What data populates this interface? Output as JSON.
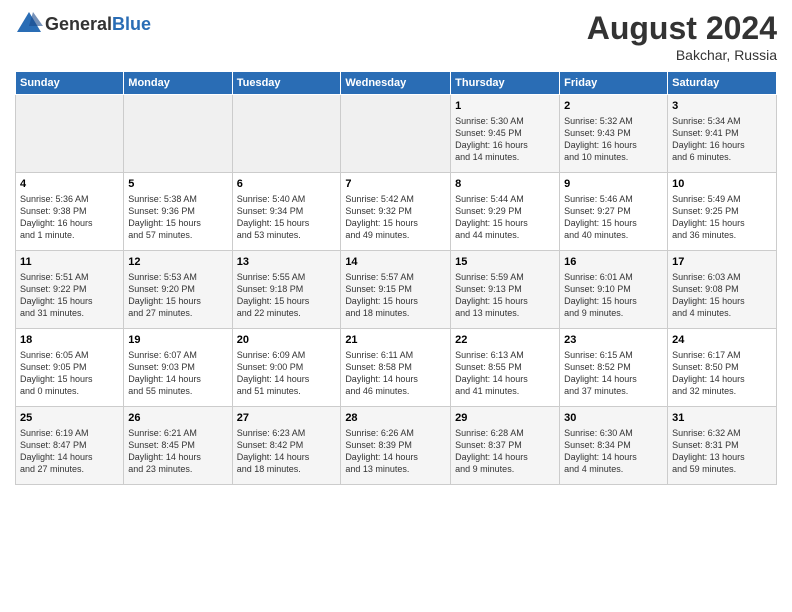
{
  "header": {
    "logo_general": "General",
    "logo_blue": "Blue",
    "month_year": "August 2024",
    "location": "Bakchar, Russia"
  },
  "weekdays": [
    "Sunday",
    "Monday",
    "Tuesday",
    "Wednesday",
    "Thursday",
    "Friday",
    "Saturday"
  ],
  "weeks": [
    [
      {
        "day": "",
        "info": ""
      },
      {
        "day": "",
        "info": ""
      },
      {
        "day": "",
        "info": ""
      },
      {
        "day": "",
        "info": ""
      },
      {
        "day": "1",
        "info": "Sunrise: 5:30 AM\nSunset: 9:45 PM\nDaylight: 16 hours\nand 14 minutes."
      },
      {
        "day": "2",
        "info": "Sunrise: 5:32 AM\nSunset: 9:43 PM\nDaylight: 16 hours\nand 10 minutes."
      },
      {
        "day": "3",
        "info": "Sunrise: 5:34 AM\nSunset: 9:41 PM\nDaylight: 16 hours\nand 6 minutes."
      }
    ],
    [
      {
        "day": "4",
        "info": "Sunrise: 5:36 AM\nSunset: 9:38 PM\nDaylight: 16 hours\nand 1 minute."
      },
      {
        "day": "5",
        "info": "Sunrise: 5:38 AM\nSunset: 9:36 PM\nDaylight: 15 hours\nand 57 minutes."
      },
      {
        "day": "6",
        "info": "Sunrise: 5:40 AM\nSunset: 9:34 PM\nDaylight: 15 hours\nand 53 minutes."
      },
      {
        "day": "7",
        "info": "Sunrise: 5:42 AM\nSunset: 9:32 PM\nDaylight: 15 hours\nand 49 minutes."
      },
      {
        "day": "8",
        "info": "Sunrise: 5:44 AM\nSunset: 9:29 PM\nDaylight: 15 hours\nand 44 minutes."
      },
      {
        "day": "9",
        "info": "Sunrise: 5:46 AM\nSunset: 9:27 PM\nDaylight: 15 hours\nand 40 minutes."
      },
      {
        "day": "10",
        "info": "Sunrise: 5:49 AM\nSunset: 9:25 PM\nDaylight: 15 hours\nand 36 minutes."
      }
    ],
    [
      {
        "day": "11",
        "info": "Sunrise: 5:51 AM\nSunset: 9:22 PM\nDaylight: 15 hours\nand 31 minutes."
      },
      {
        "day": "12",
        "info": "Sunrise: 5:53 AM\nSunset: 9:20 PM\nDaylight: 15 hours\nand 27 minutes."
      },
      {
        "day": "13",
        "info": "Sunrise: 5:55 AM\nSunset: 9:18 PM\nDaylight: 15 hours\nand 22 minutes."
      },
      {
        "day": "14",
        "info": "Sunrise: 5:57 AM\nSunset: 9:15 PM\nDaylight: 15 hours\nand 18 minutes."
      },
      {
        "day": "15",
        "info": "Sunrise: 5:59 AM\nSunset: 9:13 PM\nDaylight: 15 hours\nand 13 minutes."
      },
      {
        "day": "16",
        "info": "Sunrise: 6:01 AM\nSunset: 9:10 PM\nDaylight: 15 hours\nand 9 minutes."
      },
      {
        "day": "17",
        "info": "Sunrise: 6:03 AM\nSunset: 9:08 PM\nDaylight: 15 hours\nand 4 minutes."
      }
    ],
    [
      {
        "day": "18",
        "info": "Sunrise: 6:05 AM\nSunset: 9:05 PM\nDaylight: 15 hours\nand 0 minutes."
      },
      {
        "day": "19",
        "info": "Sunrise: 6:07 AM\nSunset: 9:03 PM\nDaylight: 14 hours\nand 55 minutes."
      },
      {
        "day": "20",
        "info": "Sunrise: 6:09 AM\nSunset: 9:00 PM\nDaylight: 14 hours\nand 51 minutes."
      },
      {
        "day": "21",
        "info": "Sunrise: 6:11 AM\nSunset: 8:58 PM\nDaylight: 14 hours\nand 46 minutes."
      },
      {
        "day": "22",
        "info": "Sunrise: 6:13 AM\nSunset: 8:55 PM\nDaylight: 14 hours\nand 41 minutes."
      },
      {
        "day": "23",
        "info": "Sunrise: 6:15 AM\nSunset: 8:52 PM\nDaylight: 14 hours\nand 37 minutes."
      },
      {
        "day": "24",
        "info": "Sunrise: 6:17 AM\nSunset: 8:50 PM\nDaylight: 14 hours\nand 32 minutes."
      }
    ],
    [
      {
        "day": "25",
        "info": "Sunrise: 6:19 AM\nSunset: 8:47 PM\nDaylight: 14 hours\nand 27 minutes."
      },
      {
        "day": "26",
        "info": "Sunrise: 6:21 AM\nSunset: 8:45 PM\nDaylight: 14 hours\nand 23 minutes."
      },
      {
        "day": "27",
        "info": "Sunrise: 6:23 AM\nSunset: 8:42 PM\nDaylight: 14 hours\nand 18 minutes."
      },
      {
        "day": "28",
        "info": "Sunrise: 6:26 AM\nSunset: 8:39 PM\nDaylight: 14 hours\nand 13 minutes."
      },
      {
        "day": "29",
        "info": "Sunrise: 6:28 AM\nSunset: 8:37 PM\nDaylight: 14 hours\nand 9 minutes."
      },
      {
        "day": "30",
        "info": "Sunrise: 6:30 AM\nSunset: 8:34 PM\nDaylight: 14 hours\nand 4 minutes."
      },
      {
        "day": "31",
        "info": "Sunrise: 6:32 AM\nSunset: 8:31 PM\nDaylight: 13 hours\nand 59 minutes."
      }
    ]
  ]
}
